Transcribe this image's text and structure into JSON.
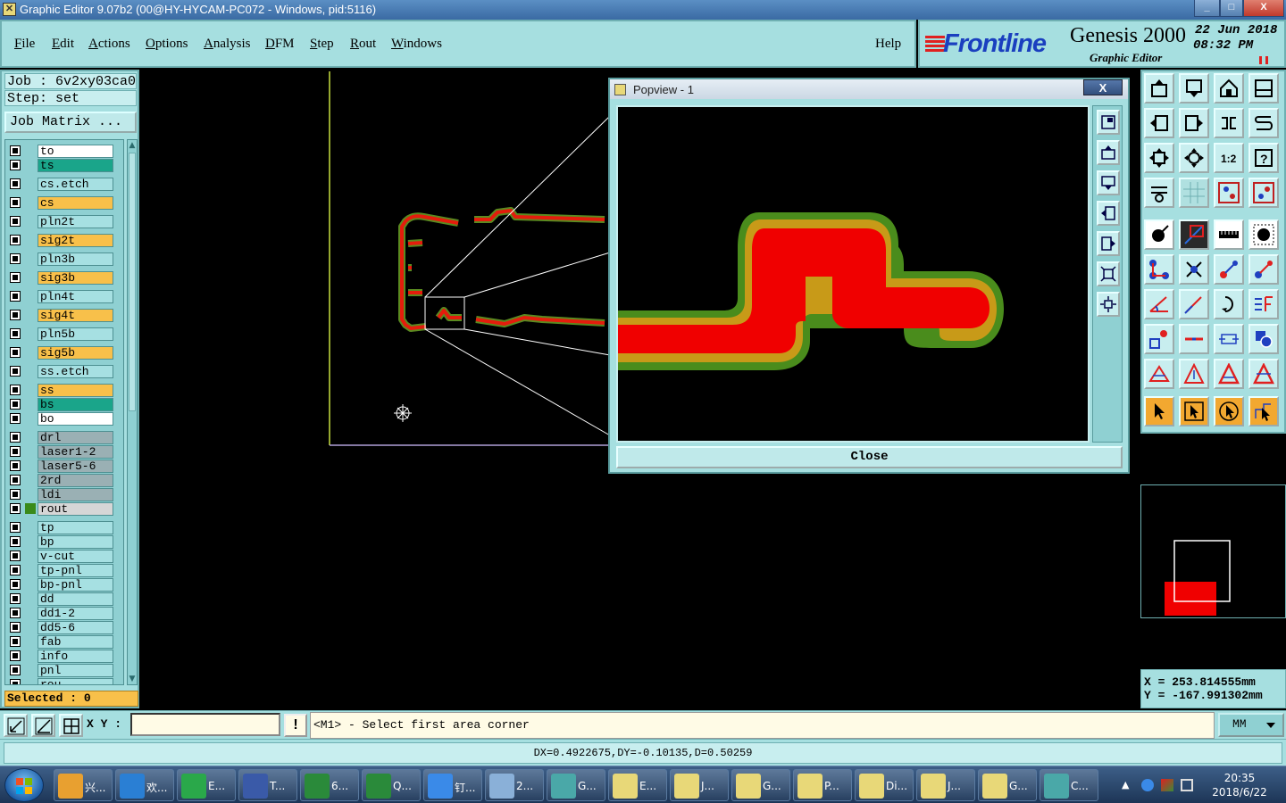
{
  "window": {
    "title": "Graphic Editor 9.07b2 (00@HY-HYCAM-PC072 - Windows, pid:5116)",
    "min": "_",
    "max": "□",
    "close": "X"
  },
  "menu": {
    "items": [
      {
        "first": "F",
        "rest": "ile"
      },
      {
        "first": "E",
        "rest": "dit"
      },
      {
        "first": "A",
        "rest": "ctions"
      },
      {
        "first": "O",
        "rest": "ptions"
      },
      {
        "first": "A",
        "rest": "nalysis"
      },
      {
        "first": "D",
        "rest": "FM"
      },
      {
        "first": "S",
        "rest": "tep"
      },
      {
        "first": "R",
        "rest": "out"
      },
      {
        "first": "W",
        "rest": "indows"
      }
    ],
    "help": "Help"
  },
  "logo": {
    "brand": "Frontline",
    "product": "Genesis 2000",
    "subtitle": "Graphic Editor",
    "date": "22 Jun 2018",
    "time": "08:32 PM"
  },
  "job": {
    "job_line": "Job : 6v2xy03ca0",
    "step_line": "Step: set",
    "job_matrix": "Job Matrix ..."
  },
  "layers": [
    {
      "name": "to",
      "color": "#ffffff"
    },
    {
      "name": "ts",
      "color": "#1aa58a"
    },
    {
      "name": "cs.etch",
      "color": "#a6e0e2"
    },
    {
      "name": "cs",
      "color": "#f8c04a"
    },
    {
      "name": "pln2t",
      "color": "#a6e0e2"
    },
    {
      "name": "sig2t",
      "color": "#f8c04a"
    },
    {
      "name": "pln3b",
      "color": "#a6e0e2"
    },
    {
      "name": "sig3b",
      "color": "#f8c04a"
    },
    {
      "name": "pln4t",
      "color": "#a6e0e2"
    },
    {
      "name": "sig4t",
      "color": "#f8c04a"
    },
    {
      "name": "pln5b",
      "color": "#a6e0e2"
    },
    {
      "name": "sig5b",
      "color": "#f8c04a"
    },
    {
      "name": "ss.etch",
      "color": "#a6e0e2"
    },
    {
      "name": "ss",
      "color": "#f8c04a"
    },
    {
      "name": "bs",
      "color": "#1aa58a"
    },
    {
      "name": "bo",
      "color": "#ffffff"
    },
    {
      "name": "drl",
      "color": "#9ab0b4"
    },
    {
      "name": "laser1-2",
      "color": "#9ab0b4"
    },
    {
      "name": "laser5-6",
      "color": "#9ab0b4"
    },
    {
      "name": "2rd",
      "color": "#9ab0b4"
    },
    {
      "name": "ldi",
      "color": "#9ab0b4"
    },
    {
      "name": "rout",
      "color": "#d6d6d6"
    },
    {
      "name": "tp",
      "color": "#a6e0e2"
    },
    {
      "name": "bp",
      "color": "#a6e0e2"
    },
    {
      "name": "v-cut",
      "color": "#a6e0e2"
    },
    {
      "name": "tp-pnl",
      "color": "#a6e0e2"
    },
    {
      "name": "bp-pnl",
      "color": "#a6e0e2"
    },
    {
      "name": "dd",
      "color": "#a6e0e2"
    },
    {
      "name": "dd1-2",
      "color": "#a6e0e2"
    },
    {
      "name": "dd5-6",
      "color": "#a6e0e2"
    },
    {
      "name": "fab",
      "color": "#a6e0e2"
    },
    {
      "name": "info",
      "color": "#a6e0e2"
    },
    {
      "name": "pnl",
      "color": "#a6e0e2"
    },
    {
      "name": "rou",
      "color": "#a6e0e2"
    }
  ],
  "selected": "Selected : 0",
  "popview": {
    "title": "Popview - 1",
    "close_x": "X",
    "close_button": "Close"
  },
  "coords": {
    "x": "X = 253.814555mm",
    "y": "Y = -167.991302mm"
  },
  "bottom": {
    "xy_label": "X Y :",
    "xy_value": "",
    "warn": "!",
    "prompt": "<M1> - Select first area corner",
    "units": "MM"
  },
  "status": "DX=0.4922675,DY=-0.10135,D=0.50259",
  "taskbar": {
    "tasks": [
      {
        "label": "兴...",
        "color": "#e8a030"
      },
      {
        "label": "欢...",
        "color": "#2a7fd4"
      },
      {
        "label": "E...",
        "color": "#2aa84a"
      },
      {
        "label": "T...",
        "color": "#3a5aa8"
      },
      {
        "label": "6...",
        "color": "#2a8a3a"
      },
      {
        "label": "Q...",
        "color": "#2a8a3a"
      },
      {
        "label": "钉...",
        "color": "#3a8ae8"
      },
      {
        "label": "2...",
        "color": "#8ab0d8"
      },
      {
        "label": "G...",
        "color": "#4aa8a8"
      },
      {
        "label": "E...",
        "color": "#e8d878"
      },
      {
        "label": "J...",
        "color": "#e8d878"
      },
      {
        "label": "G...",
        "color": "#e8d878"
      },
      {
        "label": "P...",
        "color": "#e8d878"
      },
      {
        "label": "Di...",
        "color": "#e8d878"
      },
      {
        "label": "J...",
        "color": "#e8d878"
      },
      {
        "label": "G...",
        "color": "#e8d878"
      },
      {
        "label": "C...",
        "color": "#4aa8a8"
      }
    ],
    "time": "20:35",
    "date": "2018/6/22"
  }
}
